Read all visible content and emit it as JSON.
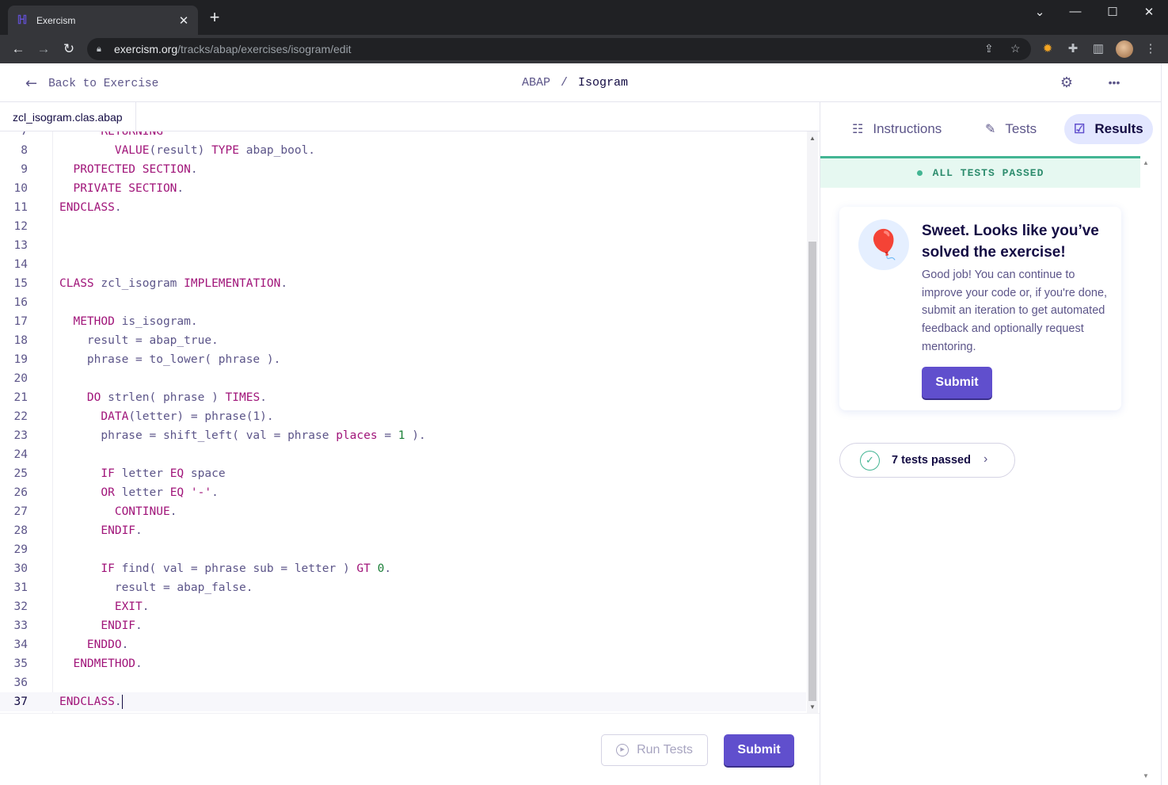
{
  "browser": {
    "tab_title": "Exercism",
    "url_host": "exercism.org",
    "url_path": "/tracks/abap/exercises/isogram/edit"
  },
  "header": {
    "back_label": "Back to Exercise",
    "track": "ABAP",
    "separator": "/",
    "exercise": "Isogram"
  },
  "editor": {
    "file_tab": "zcl_isogram.clas.abap",
    "run_tests_label": "Run Tests",
    "submit_label": "Submit"
  },
  "right_panel": {
    "tabs": [
      {
        "label": "Instructions",
        "selected": false
      },
      {
        "label": "Tests",
        "selected": false
      },
      {
        "label": "Results",
        "selected": true
      }
    ],
    "status": "ALL TESTS PASSED",
    "card_title": "Sweet. Looks like you’ve solved the exercise!",
    "card_body": "Good job! You can continue to improve your code or, if you're done, submit an iteration to get automated feedback and optionally request mentoring.",
    "card_button": "Submit",
    "tests_passed": "7 tests passed"
  },
  "colors": {
    "brand": "#604fcd",
    "success": "#43b593",
    "keyword": "#a01479"
  }
}
